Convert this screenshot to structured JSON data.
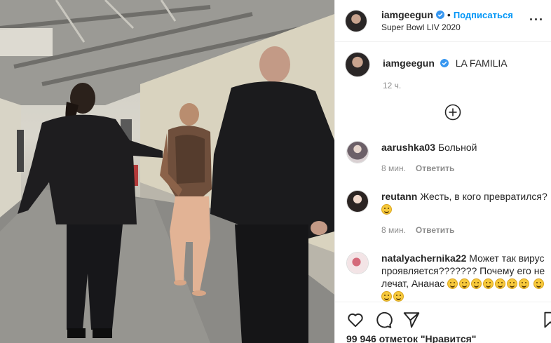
{
  "post": {
    "author": "iamgeegun",
    "follow_label": "Подписаться",
    "dot": "•",
    "location": "Super Bowl LIV 2020",
    "more_label": "···"
  },
  "caption": {
    "author": "iamgeegun",
    "text": "LA FAMILIA",
    "time": "12 ч."
  },
  "comments": [
    {
      "user": "aarushka03",
      "text": "Больной",
      "time": "8 мин.",
      "reply": "Ответить"
    },
    {
      "user": "reutann",
      "text": "Жесть, в кого превратился?",
      "time": "8 мин.",
      "reply": "Ответить"
    },
    {
      "user": "natalyachernika22",
      "text": "Может так вирус проявляется??????? Почему его не лечат, Ананас"
    }
  ],
  "likes": "99 946 отметок \"Нравится\"",
  "icons": {
    "verified": "verified-badge-icon",
    "load_more": "plus-circle-icon",
    "like": "heart-icon",
    "comment": "comment-bubble-icon",
    "share": "paper-plane-icon",
    "save": "bookmark-icon"
  },
  "colors": {
    "accent": "#0095f6",
    "secondary_text": "#8e8e8e",
    "border": "#efefef"
  }
}
